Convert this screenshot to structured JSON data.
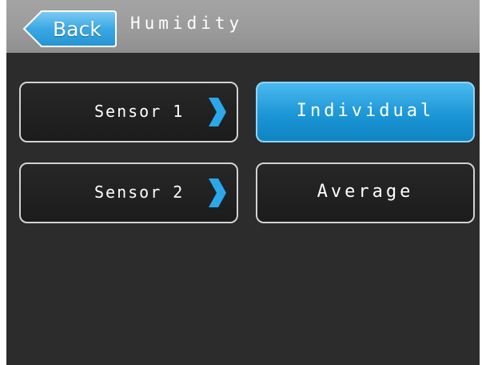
{
  "header": {
    "back_label": "Back",
    "title": "Humidity"
  },
  "sensors": [
    {
      "label": "Sensor 1",
      "icon": "chevron-right-icon"
    },
    {
      "label": "Sensor 2",
      "icon": "chevron-right-icon"
    }
  ],
  "modes": [
    {
      "label": "Individual",
      "selected": true
    },
    {
      "label": "Average",
      "selected": false
    }
  ],
  "colors": {
    "accent": "#1f9bdb",
    "header_bg": "#9c9c9c",
    "screen_bg": "#2c2c2c"
  }
}
